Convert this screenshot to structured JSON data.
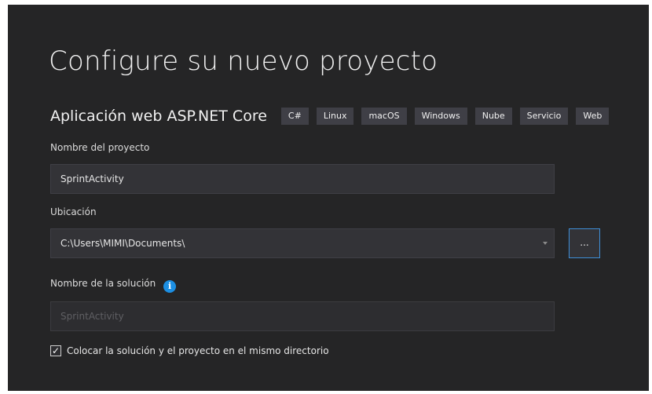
{
  "header": {
    "title": "Configure su nuevo proyecto"
  },
  "template": {
    "name": "Aplicación web ASP.NET Core",
    "tags": [
      "C#",
      "Linux",
      "macOS",
      "Windows",
      "Nube",
      "Servicio",
      "Web"
    ]
  },
  "form": {
    "project_name_label": "Nombre del proyecto",
    "project_name_value": "SprintActivity",
    "location_label": "Ubicación",
    "location_value": "C:\\Users\\MIMI\\Documents\\",
    "browse_label": "...",
    "solution_name_label": "Nombre de la solución",
    "solution_info_icon": "i",
    "solution_name_value": "SprintActivity",
    "same_directory_label": "Colocar la solución y el proyecto en el mismo directorio",
    "same_directory_checked": true,
    "checkmark": "✓"
  },
  "colors": {
    "background": "#252526",
    "field": "#333337",
    "accent": "#3e8fd8",
    "info": "#1c8fe3",
    "tag": "#3f3f46"
  }
}
